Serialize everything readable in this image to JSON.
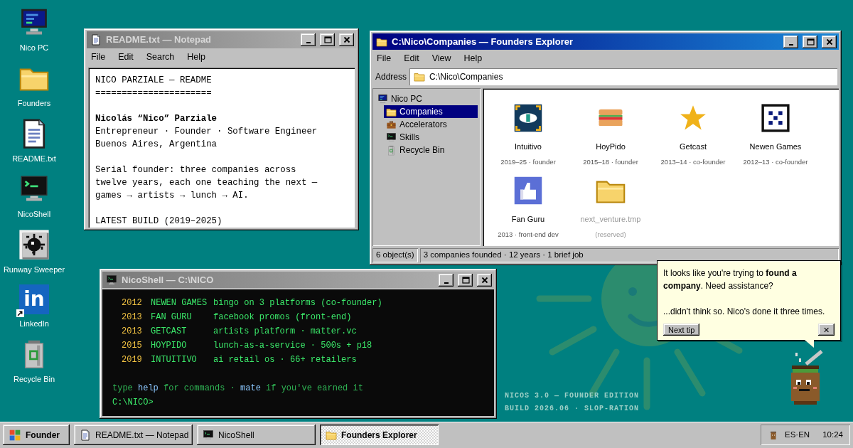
{
  "desktop_icons": [
    {
      "label": "Nico PC",
      "kind": "computer"
    },
    {
      "label": "Founders",
      "kind": "folder"
    },
    {
      "label": "README.txt",
      "kind": "document"
    },
    {
      "label": "NicoShell",
      "kind": "terminal"
    },
    {
      "label": "Runway Sweeper",
      "kind": "sweeper"
    },
    {
      "label": "LinkedIn",
      "kind": "logo",
      "glyph": "in"
    },
    {
      "label": "Recycle Bin",
      "kind": "bin"
    }
  ],
  "notepad": {
    "title": "README.txt — Notepad",
    "active": false,
    "menu": [
      "File",
      "Edit",
      "Search",
      "Help"
    ],
    "paragraphs": [
      [
        {
          "text": "NICO PARZIALE — README",
          "bold": false
        },
        {
          "text": "======================",
          "bold": false
        }
      ],
      [
        {
          "text": "Nicolás “Nico” Parziale",
          "bold": true
        },
        {
          "text": "Entrepreneur · Founder · Software Engineer",
          "bold": false
        },
        {
          "text": "Buenos Aires, Argentina",
          "bold": false
        }
      ],
      [
        {
          "text": "Serial founder: three companies across",
          "bold": false
        },
        {
          "text": "twelve years, each one teaching the next —",
          "bold": false
        },
        {
          "text": "games → artists → lunch → AI.",
          "bold": false
        }
      ],
      [
        {
          "text": "LATEST BUILD (2019–2025)",
          "bold": false
        }
      ]
    ]
  },
  "explorer": {
    "title": "C:\\Nico\\Companies — Founders Explorer",
    "active": true,
    "menu": [
      "File",
      "Edit",
      "View",
      "Help"
    ],
    "address_label": "Address",
    "address": "C:\\Nico\\Companies",
    "tree": [
      {
        "label": "Nico PC",
        "kind": "computer",
        "selected": false,
        "children": [
          {
            "label": "Companies",
            "kind": "folder",
            "selected": true
          },
          {
            "label": "Accelerators",
            "kind": "briefcase",
            "selected": false
          },
          {
            "label": "Skills",
            "kind": "terminal",
            "selected": false
          },
          {
            "label": "Recycle Bin",
            "kind": "bin",
            "selected": false
          }
        ]
      }
    ],
    "items": [
      {
        "name": "Intuitivo",
        "detail": "2019–25 · founder",
        "kind": "eye",
        "reserved": false
      },
      {
        "name": "HoyPido",
        "detail": "2015–18 · founder",
        "kind": "burger",
        "reserved": false
      },
      {
        "name": "Getcast",
        "detail": "2013–14 · co-founder",
        "kind": "star",
        "reserved": false
      },
      {
        "name": "Newen Games",
        "detail": "2012–13 · co-founder",
        "kind": "dice",
        "reserved": false
      },
      {
        "name": "Fan Guru",
        "detail": "2013 · front-end dev",
        "kind": "thumb",
        "reserved": false
      },
      {
        "name": "next_venture.tmp",
        "detail": "(reserved)",
        "kind": "folder",
        "reserved": true
      }
    ],
    "status_bar": [
      "6 object(s)",
      "3 companies founded · 12 years · 1 brief job"
    ]
  },
  "shell": {
    "title": "NicoShell — C:\\NICO",
    "active": false,
    "rows": [
      {
        "year": "2012",
        "name": "NEWEN GAMES",
        "description": "bingo on 3 platforms (co-founder)"
      },
      {
        "year": "2013",
        "name": "FAN GURU",
        "description": "facebook promos (front-end)"
      },
      {
        "year": "2013",
        "name": "GETCAST",
        "description": "artists platform · matter.vc"
      },
      {
        "year": "2015",
        "name": "HOYPIDO",
        "description": "lunch-as-a-service · 500s + p18"
      },
      {
        "year": "2019",
        "name": "INTUITIVO",
        "description": "ai retail os · 66+ retailers"
      }
    ],
    "hint": [
      {
        "text": "type ",
        "kind": "plain"
      },
      {
        "text": "help",
        "kind": "command"
      },
      {
        "text": " for commands · ",
        "kind": "plain"
      },
      {
        "text": "mate",
        "kind": "command"
      },
      {
        "text": " if you've earned it",
        "kind": "plain"
      }
    ],
    "prompt": "C:\\NICO>"
  },
  "assistant": {
    "paragraphs": [
      "It looks like you're trying to **found a company**. Need assistance?",
      "...didn't think so. Nico's done it three times."
    ],
    "next_button": "Next tip",
    "close_button": "✕"
  },
  "wallpaper_text": [
    "NICOS 3.0 — FOUNDER EDITION",
    "BUILD 2026.06 · SLOP-RATION"
  ],
  "taskbar": {
    "start": "Founder",
    "tasks": [
      {
        "label": "README.txt — Notepad",
        "kind": "document",
        "selected": false
      },
      {
        "label": "NicoShell",
        "kind": "terminal",
        "selected": false
      },
      {
        "label": "Founders Explorer",
        "kind": "folder",
        "selected": true
      }
    ],
    "language": "ES·EN",
    "clock": "10:24"
  }
}
